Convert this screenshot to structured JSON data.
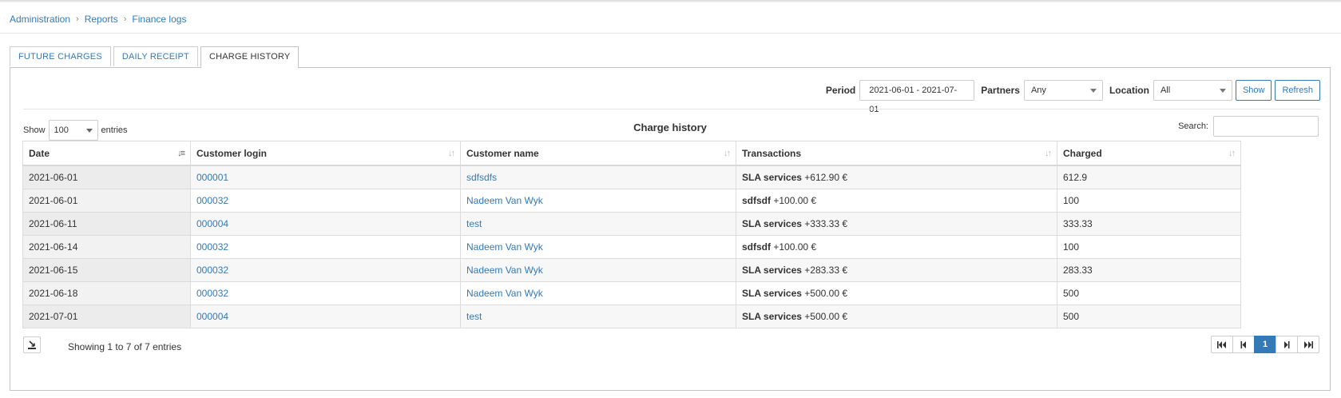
{
  "breadcrumb": [
    "Administration",
    "Reports",
    "Finance logs"
  ],
  "tabs": [
    "FUTURE CHARGES",
    "DAILY RECEIPT",
    "CHARGE HISTORY"
  ],
  "active_tab": "CHARGE HISTORY",
  "filters": {
    "period_label": "Period",
    "period_value": "2021-06-01 - 2021-07-01",
    "partners_label": "Partners",
    "partners_value": "Any",
    "location_label": "Location",
    "location_value": "All",
    "show_button": "Show",
    "refresh_button": "Refresh"
  },
  "table_controls": {
    "show_label": "Show",
    "entries_value": "100",
    "entries_label": "entries",
    "title": "Charge history",
    "search_label": "Search:"
  },
  "columns": [
    "Date",
    "Customer login",
    "Customer name",
    "Transactions",
    "Charged"
  ],
  "rows": [
    {
      "date": "2021-06-01",
      "login": "000001",
      "name": "sdfsdfs",
      "tx_type": "SLA services",
      "tx_amount": "+612.90 €",
      "charged": "612.9"
    },
    {
      "date": "2021-06-01",
      "login": "000032",
      "name": "Nadeem Van Wyk",
      "tx_type": "sdfsdf",
      "tx_amount": "+100.00 €",
      "charged": "100"
    },
    {
      "date": "2021-06-11",
      "login": "000004",
      "name": "test",
      "tx_type": "SLA services",
      "tx_amount": "+333.33 €",
      "charged": "333.33"
    },
    {
      "date": "2021-06-14",
      "login": "000032",
      "name": "Nadeem Van Wyk",
      "tx_type": "sdfsdf",
      "tx_amount": "+100.00 €",
      "charged": "100"
    },
    {
      "date": "2021-06-15",
      "login": "000032",
      "name": "Nadeem Van Wyk",
      "tx_type": "SLA services",
      "tx_amount": "+283.33 €",
      "charged": "283.33"
    },
    {
      "date": "2021-06-18",
      "login": "000032",
      "name": "Nadeem Van Wyk",
      "tx_type": "SLA services",
      "tx_amount": "+500.00 €",
      "charged": "500"
    },
    {
      "date": "2021-07-01",
      "login": "000004",
      "name": "test",
      "tx_type": "SLA services",
      "tx_amount": "+500.00 €",
      "charged": "500"
    }
  ],
  "footer": {
    "info": "Showing 1 to 7 of 7 entries",
    "current_page": "1",
    "icons": [
      "export-icon",
      "first-page-icon",
      "prev-page-icon",
      "next-page-icon",
      "last-page-icon"
    ]
  },
  "colors": {
    "accent": "#337ab7",
    "border": "#c4c4c4"
  }
}
